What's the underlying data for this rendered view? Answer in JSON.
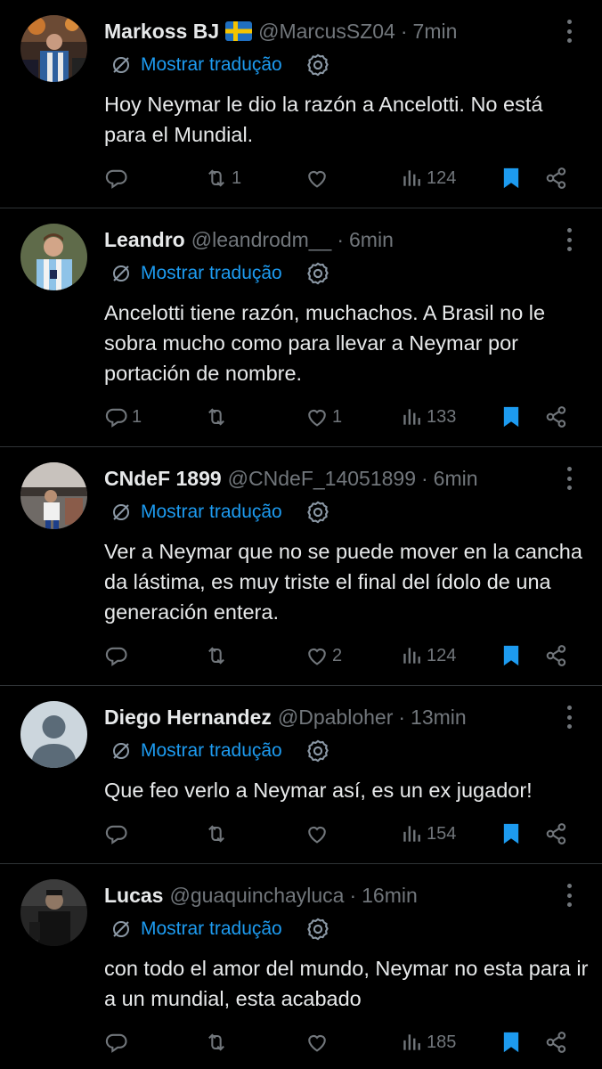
{
  "colors": {
    "background": "#000000",
    "text_primary": "#e7e9ea",
    "text_secondary": "#71767b",
    "accent": "#1d9bf0",
    "divider": "#2f3336"
  },
  "posts": [
    {
      "display_name": "Markoss BJ",
      "flag": "sweden-flag-icon",
      "handle": "@MarcusSZ04",
      "separator": "·",
      "time": "7min",
      "translate_label": "Mostrar tradução",
      "text": "Hoy Neymar le dio la razón a Ancelotti. No está para el Mundial.",
      "replies": "",
      "reposts": "1",
      "likes": "",
      "views": "124",
      "bookmarked": true
    },
    {
      "display_name": "Leandro",
      "handle": "@leandrodm__",
      "separator": "·",
      "time": "6min",
      "translate_label": "Mostrar tradução",
      "text": "Ancelotti tiene razón, muchachos. A Brasil no le sobra mucho como para llevar a Neymar por portación de nombre.",
      "replies": "1",
      "reposts": "",
      "likes": "1",
      "views": "133",
      "bookmarked": true
    },
    {
      "display_name": "CNdeF 1899",
      "handle": "@CNdeF_14051899",
      "separator": "·",
      "time": "6min",
      "translate_label": "Mostrar tradução",
      "text": "Ver a Neymar que no se puede mover en la cancha da lástima, es muy triste el final del ídolo de una generación entera.",
      "replies": "",
      "reposts": "",
      "likes": "2",
      "views": "124",
      "bookmarked": true
    },
    {
      "display_name": "Diego Hernandez",
      "handle": "@Dpabloher",
      "separator": "·",
      "time": "13min",
      "translate_label": "Mostrar tradução",
      "text": "Que feo verlo a Neymar así, es un ex jugador!",
      "replies": "",
      "reposts": "",
      "likes": "",
      "views": "154",
      "bookmarked": true
    },
    {
      "display_name": "Lucas",
      "handle": "@guaquinchayluca",
      "separator": "·",
      "time": "16min",
      "translate_label": "Mostrar tradução",
      "text": "con todo el amor del mundo, Neymar no esta para ir a un mundial, esta acabado",
      "replies": "",
      "reposts": "",
      "likes": "",
      "views": "185",
      "bookmarked": true
    }
  ]
}
